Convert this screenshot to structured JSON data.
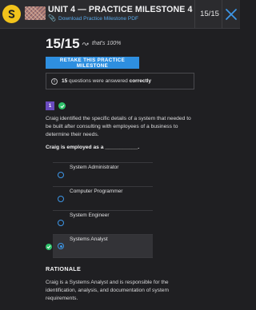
{
  "header": {
    "title": "UNIT 4 — PRACTICE MILESTONE 4",
    "pdf_link": "Download Practice Milestone PDF",
    "counter": "15/15"
  },
  "score": {
    "value": "15/15",
    "note": "that's 100%"
  },
  "retake_label": "RETAKE THIS PRACTICE MILESTONE",
  "info": {
    "count": "15",
    "text": "questions were answered",
    "status": "correctly"
  },
  "question": {
    "number": "1",
    "text": "Craig identified the specific details of a system that needed to be built after consulting with employees of a business to determine their needs.",
    "prompt": "Craig is employed as a ___________.",
    "answers": [
      {
        "label": "System Administrator",
        "selected": false
      },
      {
        "label": "Computer Programmer",
        "selected": false
      },
      {
        "label": "System Engineer",
        "selected": false
      },
      {
        "label": "Systems Analyst",
        "selected": true
      }
    ]
  },
  "rationale": {
    "title": "RATIONALE",
    "text": "Craig is a Systems Analyst and is responsible for the identification, analysis, and documentation of system requirements."
  }
}
